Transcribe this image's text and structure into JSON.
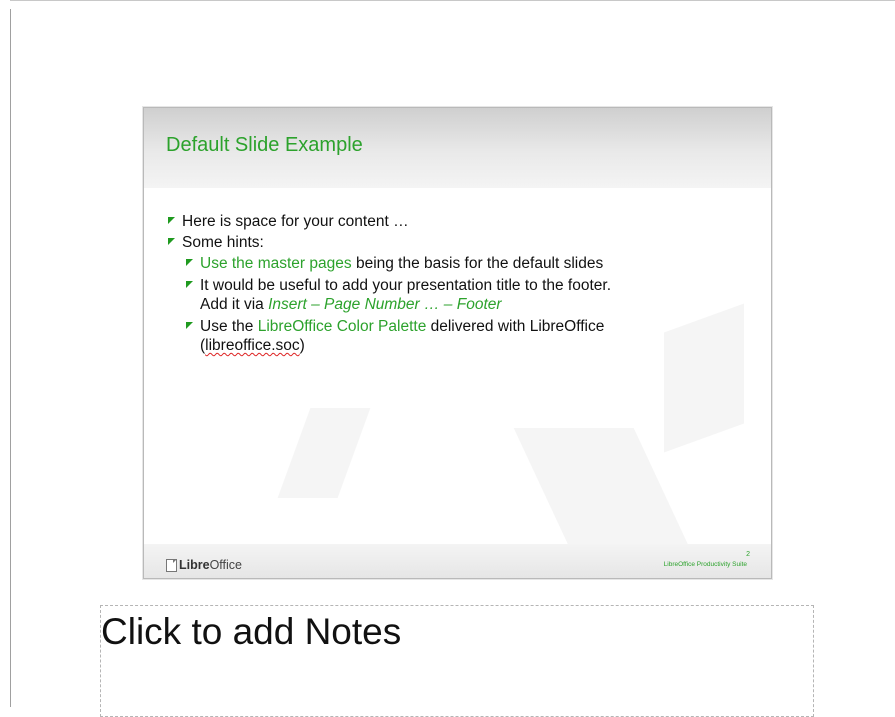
{
  "slide": {
    "title": "Default Slide Example",
    "bullets": {
      "b1": "Here is space for your content …",
      "b2": "Some hints:",
      "h1_link": "Use the master pages",
      "h1_rest": " being the basis for the default slides",
      "h2_line1": "It would be useful to add your presentation title to the footer.",
      "h2_prefix": "Add it via ",
      "h2_path": "Insert – Page Number … – Footer",
      "h3_prefix": "Use the ",
      "h3_link": "LibreOffice Color Palette",
      "h3_suffix": " delivered with LibreOffice",
      "h3_open": "(",
      "h3_file": "libreoffice.soc",
      "h3_close": ")"
    },
    "footer": {
      "logo_bold": "Libre",
      "logo_rest": "Office",
      "text": "LibreOffice Productivity Suite",
      "page_number": "2"
    },
    "accent_color": "#2ca22c"
  },
  "notes": {
    "placeholder": "Click to add Notes"
  }
}
